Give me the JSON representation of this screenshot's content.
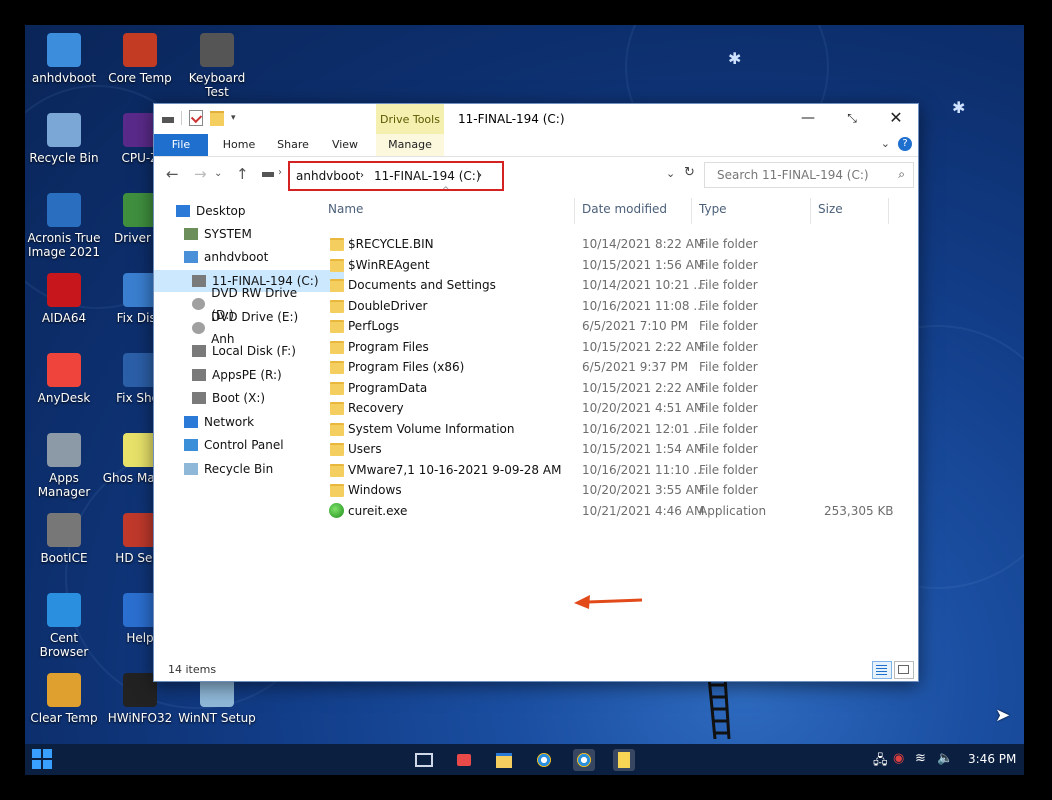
{
  "desktop": {
    "icons": [
      {
        "label": "anhdvboot",
        "icon": "computer-icon",
        "color": "#3c8ddc"
      },
      {
        "label": "Core Temp",
        "icon": "core-temp-icon",
        "color": "#c23b22"
      },
      {
        "label": "Keyboard Test",
        "icon": "keyboard-test-icon",
        "color": "#555555"
      },
      {
        "label": "Recycle Bin",
        "icon": "recycle-bin-icon",
        "color": "#7aa7d6"
      },
      {
        "label": "CPU-Z",
        "icon": "cpu-z-icon",
        "color": "#5a2a8a"
      },
      {
        "label": "Acronis True Image 2021",
        "icon": "acronis-icon",
        "color": "#2a6fbf"
      },
      {
        "label": "Driver In",
        "icon": "driver-icon",
        "color": "#3f8f3f"
      },
      {
        "label": "AIDA64",
        "icon": "aida64-icon",
        "color": "#c8161d"
      },
      {
        "label": "Fix Disp",
        "icon": "fix-display-icon",
        "color": "#3a7fd0"
      },
      {
        "label": "AnyDesk",
        "icon": "anydesk-icon",
        "color": "#ef443b"
      },
      {
        "label": "Fix Shor",
        "icon": "fix-shortcut-icon",
        "color": "#2b5fa8"
      },
      {
        "label": "Apps Manager",
        "icon": "apps-manager-icon",
        "color": "#8c9aa8"
      },
      {
        "label": "Ghos Manag",
        "icon": "ghost-icon",
        "color": "#e8e26a"
      },
      {
        "label": "BootICE",
        "icon": "bootice-icon",
        "color": "#777777"
      },
      {
        "label": "HD Sent",
        "icon": "hd-sentinel-icon",
        "color": "#c0392b"
      },
      {
        "label": "Cent Browser",
        "icon": "cent-browser-icon",
        "color": "#2b8fe0"
      },
      {
        "label": "Help",
        "icon": "help-icon",
        "color": "#2b6fd0"
      },
      {
        "label": "Clear Temp",
        "icon": "clear-temp-icon",
        "color": "#e0a030"
      },
      {
        "label": "HWiNFO32",
        "icon": "hwinfo-icon",
        "color": "#222222"
      },
      {
        "label": "WinNT Setup",
        "icon": "winnt-setup-icon",
        "color": "#8fb8d8"
      }
    ]
  },
  "window": {
    "title": "11-FINAL-194 (C:)",
    "context_tab": "Drive Tools",
    "ribbon_tabs": [
      "File",
      "Home",
      "Share",
      "View",
      "Manage"
    ],
    "address": {
      "crumbs": [
        "anhdvboot",
        "11-FINAL-194 (C:)"
      ]
    },
    "search_placeholder": "Search 11-FINAL-194 (C:)",
    "nav": [
      {
        "label": "Desktop",
        "icon": "desktop-icon"
      },
      {
        "label": "SYSTEM",
        "icon": "user-icon"
      },
      {
        "label": "anhdvboot",
        "icon": "computer-icon"
      },
      {
        "label": "11-FINAL-194 (C:)",
        "icon": "drive-icon",
        "selected": true
      },
      {
        "label": "DVD RW Drive (D:)",
        "icon": "dvd-drive-icon"
      },
      {
        "label": "DVD Drive (E:) Anh",
        "icon": "dvd-drive-icon"
      },
      {
        "label": "Local Disk (F:)",
        "icon": "drive-icon"
      },
      {
        "label": "AppsPE (R:)",
        "icon": "drive-icon"
      },
      {
        "label": "Boot (X:)",
        "icon": "drive-icon"
      },
      {
        "label": "Network",
        "icon": "network-icon"
      },
      {
        "label": "Control Panel",
        "icon": "control-panel-icon"
      },
      {
        "label": "Recycle Bin",
        "icon": "recycle-bin-icon"
      }
    ],
    "columns": {
      "name": "Name",
      "date": "Date modified",
      "type": "Type",
      "size": "Size"
    },
    "files": [
      {
        "name": "$RECYCLE.BIN",
        "date": "10/14/2021 8:22 AM",
        "type": "File folder",
        "size": "",
        "icon": "folder-icon"
      },
      {
        "name": "$WinREAgent",
        "date": "10/15/2021 1:56 AM",
        "type": "File folder",
        "size": "",
        "icon": "folder-icon"
      },
      {
        "name": "Documents and Settings",
        "date": "10/14/2021 10:21 ...",
        "type": "File folder",
        "size": "",
        "icon": "folder-icon"
      },
      {
        "name": "DoubleDriver",
        "date": "10/16/2021 11:08 ...",
        "type": "File folder",
        "size": "",
        "icon": "folder-icon"
      },
      {
        "name": "PerfLogs",
        "date": "6/5/2021 7:10 PM",
        "type": "File folder",
        "size": "",
        "icon": "folder-icon"
      },
      {
        "name": "Program Files",
        "date": "10/15/2021 2:22 AM",
        "type": "File folder",
        "size": "",
        "icon": "folder-icon"
      },
      {
        "name": "Program Files (x86)",
        "date": "6/5/2021 9:37 PM",
        "type": "File folder",
        "size": "",
        "icon": "folder-icon"
      },
      {
        "name": "ProgramData",
        "date": "10/15/2021 2:22 AM",
        "type": "File folder",
        "size": "",
        "icon": "folder-icon"
      },
      {
        "name": "Recovery",
        "date": "10/20/2021 4:51 AM",
        "type": "File folder",
        "size": "",
        "icon": "folder-icon"
      },
      {
        "name": "System Volume Information",
        "date": "10/16/2021 12:01 ...",
        "type": "File folder",
        "size": "",
        "icon": "folder-icon"
      },
      {
        "name": "Users",
        "date": "10/15/2021 1:54 AM",
        "type": "File folder",
        "size": "",
        "icon": "folder-icon"
      },
      {
        "name": "VMware7,1 10-16-2021 9-09-28 AM",
        "date": "10/16/2021 11:10 ...",
        "type": "File folder",
        "size": "",
        "icon": "folder-icon"
      },
      {
        "name": "Windows",
        "date": "10/20/2021 3:55 AM",
        "type": "File folder",
        "size": "",
        "icon": "folder-icon"
      },
      {
        "name": "cureit.exe",
        "date": "10/21/2021 4:46 AM",
        "type": "Application",
        "size": "253,305 KB",
        "icon": "cureit-app-icon"
      }
    ],
    "status": "14 items"
  },
  "taskbar": {
    "clock": "3:46 PM",
    "apps": [
      "monitor-app-icon",
      "network-app-icon",
      "file-explorer-icon",
      "cent-browser-icon",
      "cent-browser-icon",
      "notepad-icon"
    ]
  },
  "colors": {
    "highlight_red": "#d42121",
    "ribbon_blue": "#1f6fcf",
    "drive_tools": "#f6f0b0",
    "nav_selected": "#cce8ff"
  }
}
